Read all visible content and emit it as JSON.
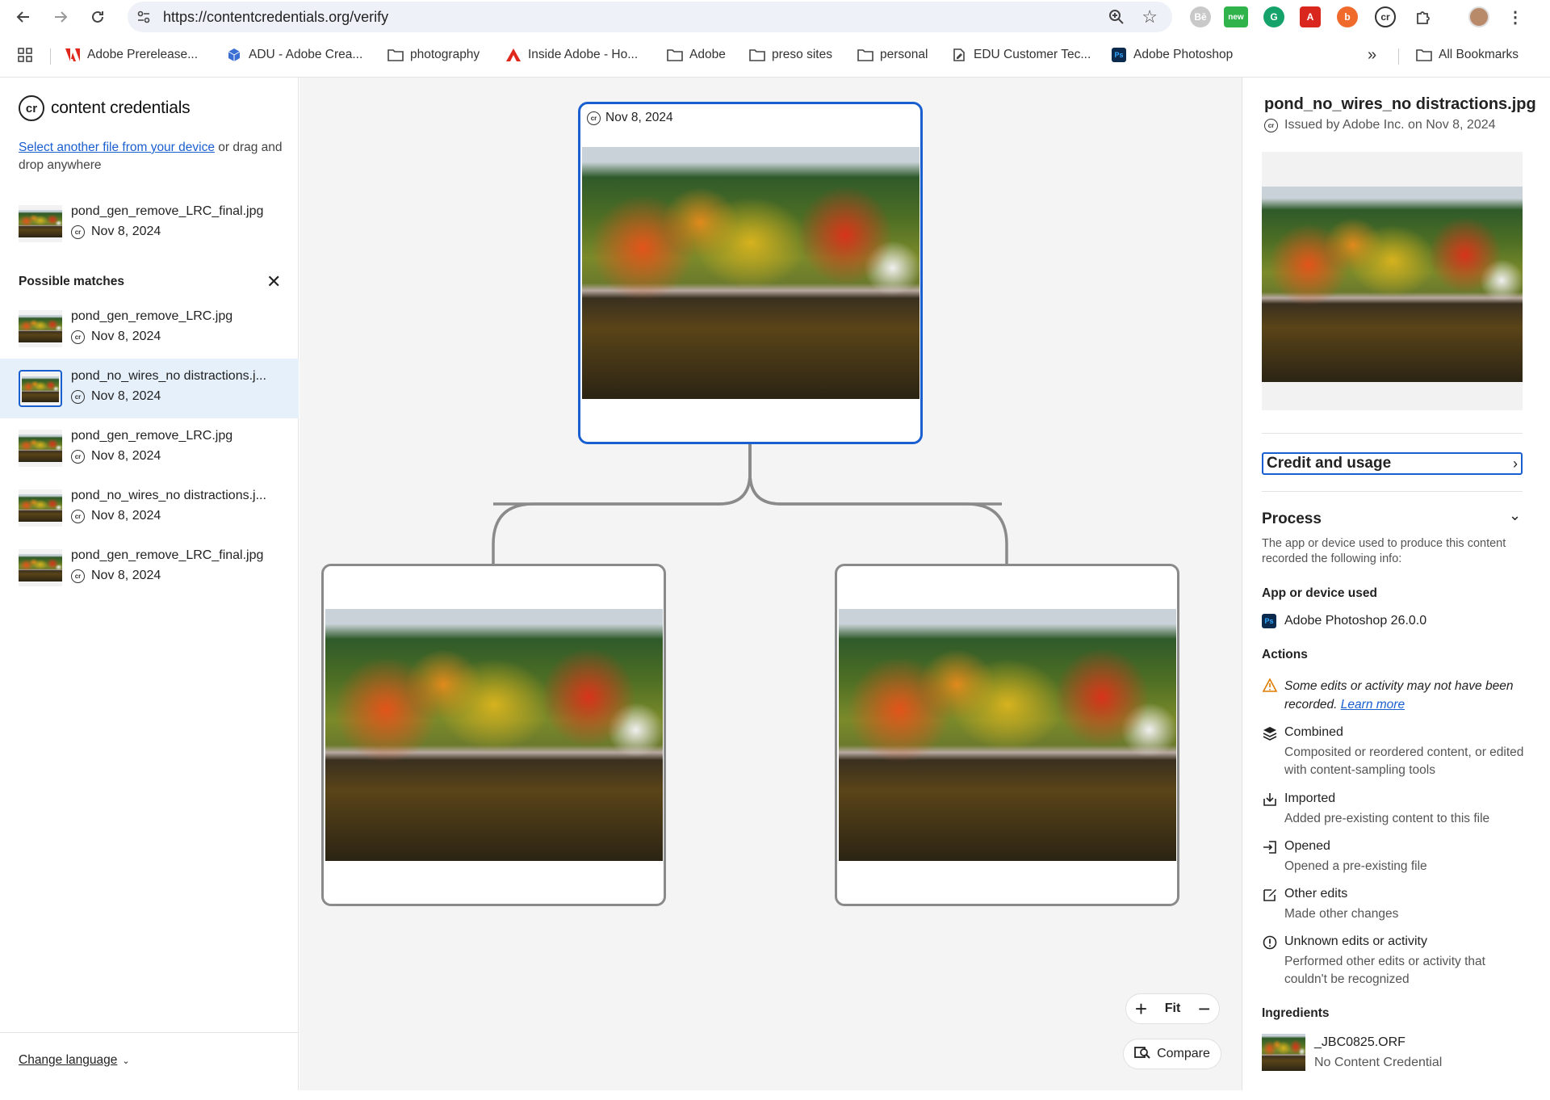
{
  "browser": {
    "url": "https://contentcredentials.org/verify",
    "extensions": [
      {
        "icon": "behance-ext-icon",
        "label": "Bē",
        "color": "#c9c9c9"
      },
      {
        "icon": "new-ext-icon",
        "label": "new",
        "color": "#2fb34a"
      },
      {
        "icon": "grammarly-ext-icon",
        "label": "G",
        "color": "#15a36b"
      },
      {
        "icon": "acrobat-ext-icon",
        "label": "A",
        "color": "#d9271e"
      },
      {
        "icon": "adobe-express-ext-icon",
        "label": "b",
        "color": "#ef6a2b"
      },
      {
        "icon": "cr-ext-icon",
        "label": "cr",
        "color": "#333333"
      }
    ],
    "bookmarks": [
      {
        "label": "Adobe Prerelease...",
        "icon": "adobe-icon"
      },
      {
        "label": "ADU - Adobe Crea...",
        "icon": "cube-icon"
      },
      {
        "label": "photography",
        "icon": "folder-icon"
      },
      {
        "label": "Inside Adobe - Ho...",
        "icon": "adobe-icon"
      },
      {
        "label": "Adobe",
        "icon": "folder-icon"
      },
      {
        "label": "preso sites",
        "icon": "folder-icon"
      },
      {
        "label": "personal",
        "icon": "folder-icon"
      },
      {
        "label": "EDU Customer Tec...",
        "icon": "edit-doc-icon"
      },
      {
        "label": "Adobe Photoshop",
        "icon": "photoshop-icon"
      }
    ],
    "more": "»",
    "all_bookmarks": "All Bookmarks"
  },
  "left": {
    "logo_text": "content credentials",
    "select_link": "Select another file from your device",
    "select_rest": " or drag and drop anywhere",
    "current_file": {
      "name": "pond_gen_remove_LRC_final.jpg",
      "date": "Nov 8, 2024"
    },
    "possible_matches_title": "Possible matches",
    "matches": [
      {
        "name": "pond_gen_remove_LRC.jpg",
        "date": "Nov 8, 2024"
      },
      {
        "name": "pond_no_wires_no distractions.j...",
        "date": "Nov 8, 2024"
      },
      {
        "name": "pond_gen_remove_LRC.jpg",
        "date": "Nov 8, 2024"
      },
      {
        "name": "pond_no_wires_no distractions.j...",
        "date": "Nov 8, 2024"
      },
      {
        "name": "pond_gen_remove_LRC_final.jpg",
        "date": "Nov 8, 2024"
      }
    ],
    "change_language": "Change language"
  },
  "canvas": {
    "root_date": "Nov 8, 2024",
    "zoom_fit": "Fit",
    "compare": "Compare"
  },
  "right": {
    "title": "pond_no_wires_no distractions.jpg",
    "issued": "Issued by Adobe Inc. on Nov 8, 2024",
    "credit_usage": "Credit and usage",
    "process_title": "Process",
    "process_desc": "The app or device used to produce this content recorded the following info:",
    "app_heading": "App or device used",
    "app_name": "Adobe Photoshop 26.0.0",
    "actions_heading": "Actions",
    "warning_text": "Some edits or activity may not have been recorded.",
    "learn_more": "Learn more",
    "actions": [
      {
        "icon": "layers-icon",
        "title": "Combined",
        "desc": "Composited or reordered content, or edited with content-sampling tools"
      },
      {
        "icon": "import-icon",
        "title": "Imported",
        "desc": "Added pre-existing content to this file"
      },
      {
        "icon": "open-icon",
        "title": "Opened",
        "desc": "Opened a pre-existing file"
      },
      {
        "icon": "edit-icon",
        "title": "Other edits",
        "desc": "Made other changes"
      },
      {
        "icon": "alert-circle-icon",
        "title": "Unknown edits or activity",
        "desc": "Performed other edits or activity that couldn't be recognized"
      }
    ],
    "ingredients_heading": "Ingredients",
    "ingredient": {
      "name": "_JBC0825.ORF",
      "status": "No Content Credential"
    }
  },
  "colors": {
    "accent": "#1a5fd0",
    "selected_row": "#e5f0fb",
    "canvas_bg": "#f4f4f4",
    "node_border": "#8a8a8a"
  }
}
